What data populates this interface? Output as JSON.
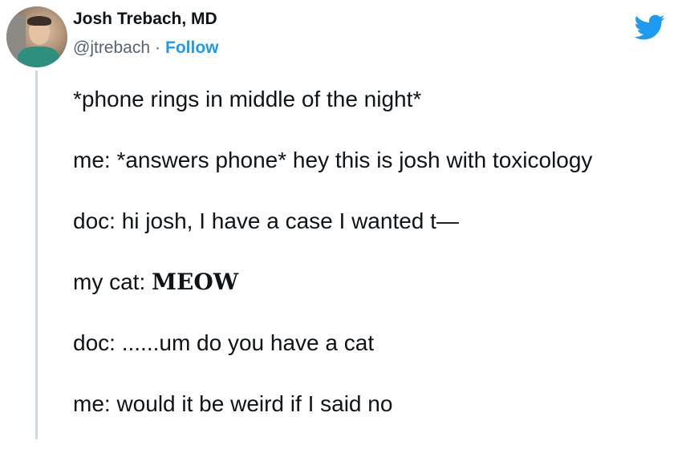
{
  "author": {
    "name": "Josh Trebach, MD",
    "handle": "@jtrebach",
    "separator": "·",
    "follow_label": "Follow"
  },
  "icons": {
    "brand": "twitter-bird-icon",
    "brand_color": "#1d9bf0"
  },
  "tweet": {
    "lines": [
      {
        "prefix": "*phone rings in middle of the night*",
        "emphasis": ""
      },
      {
        "prefix": "me: *answers phone* hey this is josh with toxicology",
        "emphasis": ""
      },
      {
        "prefix": "doc: hi josh, I have a case I wanted t—",
        "emphasis": ""
      },
      {
        "prefix": "my cat: ",
        "emphasis": "MEOW"
      },
      {
        "prefix": "doc: ......um do you have a cat",
        "emphasis": ""
      },
      {
        "prefix": "me: would it be weird if I said no",
        "emphasis": ""
      }
    ]
  }
}
